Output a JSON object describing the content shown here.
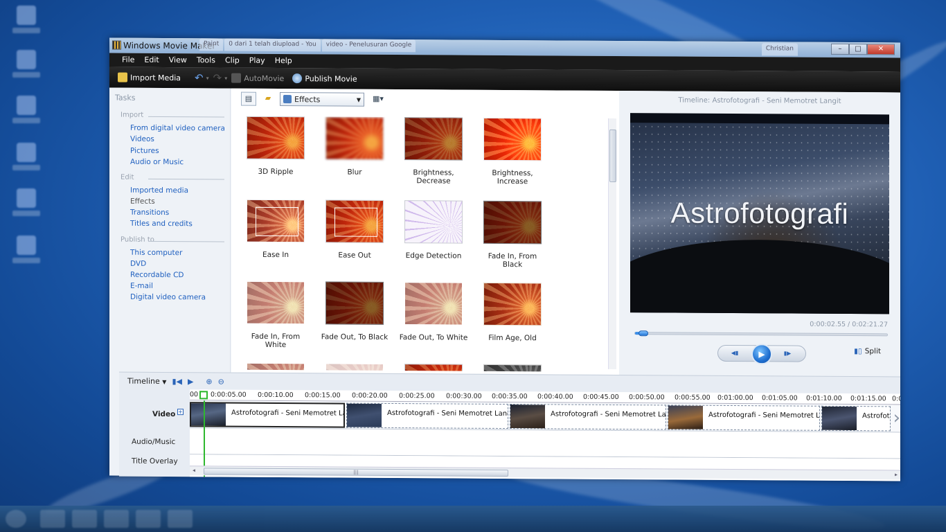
{
  "window": {
    "title": "Windows Movie Maker",
    "background_tabs": [
      "Paint",
      "0 dari 1 telah diupload - You",
      "video - Penelusuran Google"
    ],
    "user": "Christian"
  },
  "menu": [
    "File",
    "Edit",
    "View",
    "Tools",
    "Clip",
    "Play",
    "Help"
  ],
  "toolbar": {
    "import_label": "Import Media",
    "automovie_label": "AutoMovie",
    "publish_label": "Publish Movie"
  },
  "tasks": {
    "header": "Tasks",
    "import_header": "Import",
    "import_items": [
      "From digital video camera",
      "Videos",
      "Pictures",
      "Audio or Music"
    ],
    "edit_header": "Edit",
    "edit_items": [
      "Imported media",
      "Effects",
      "Transitions",
      "Titles and credits"
    ],
    "publish_header": "Publish to",
    "publish_items": [
      "This computer",
      "DVD",
      "Recordable CD",
      "E-mail",
      "Digital video camera"
    ]
  },
  "effects_panel": {
    "dropdown_value": "Effects",
    "items": [
      "3D Ripple",
      "Blur",
      "Brightness, Decrease",
      "Brightness, Increase",
      "Ease In",
      "Ease Out",
      "Edge Detection",
      "Fade In, From Black",
      "Fade In, From White",
      "Fade Out, To Black",
      "Fade Out, To White",
      "Film Age, Old"
    ]
  },
  "preview": {
    "title": "Timeline: Astrofotografi - Seni Memotret Langit",
    "overlay_text": "Astrofotografi",
    "time": "0:00:02.55 / 0:02:21.27",
    "progress_fraction": 0.018,
    "split_label": "Split"
  },
  "timeline": {
    "mode_label": "Timeline",
    "tracks": [
      "Video",
      "Audio/Music",
      "Title Overlay"
    ],
    "ruler": [
      "00",
      "0:00:05.00",
      "0:00:10.00",
      "0:00:15.00",
      "0:00:20.00",
      "0:00:25.00",
      "0:00:30.00",
      "0:00:35.00",
      "0:00:40.00",
      "0:00:45.00",
      "0:00:50.00",
      "0:00:55.00",
      "0:01:00.00",
      "0:01:05.00",
      "0:01:10.00",
      "0:01:15.00",
      "0:0"
    ],
    "clips": [
      "Astrofotografi - Seni Memotret Lan...",
      "Astrofotografi - Seni Memotret Langit",
      "Astrofotografi - Seni Memotret Lan...",
      "Astrofotografi - Seni Memotret Lan...",
      "Astrofoto"
    ]
  }
}
